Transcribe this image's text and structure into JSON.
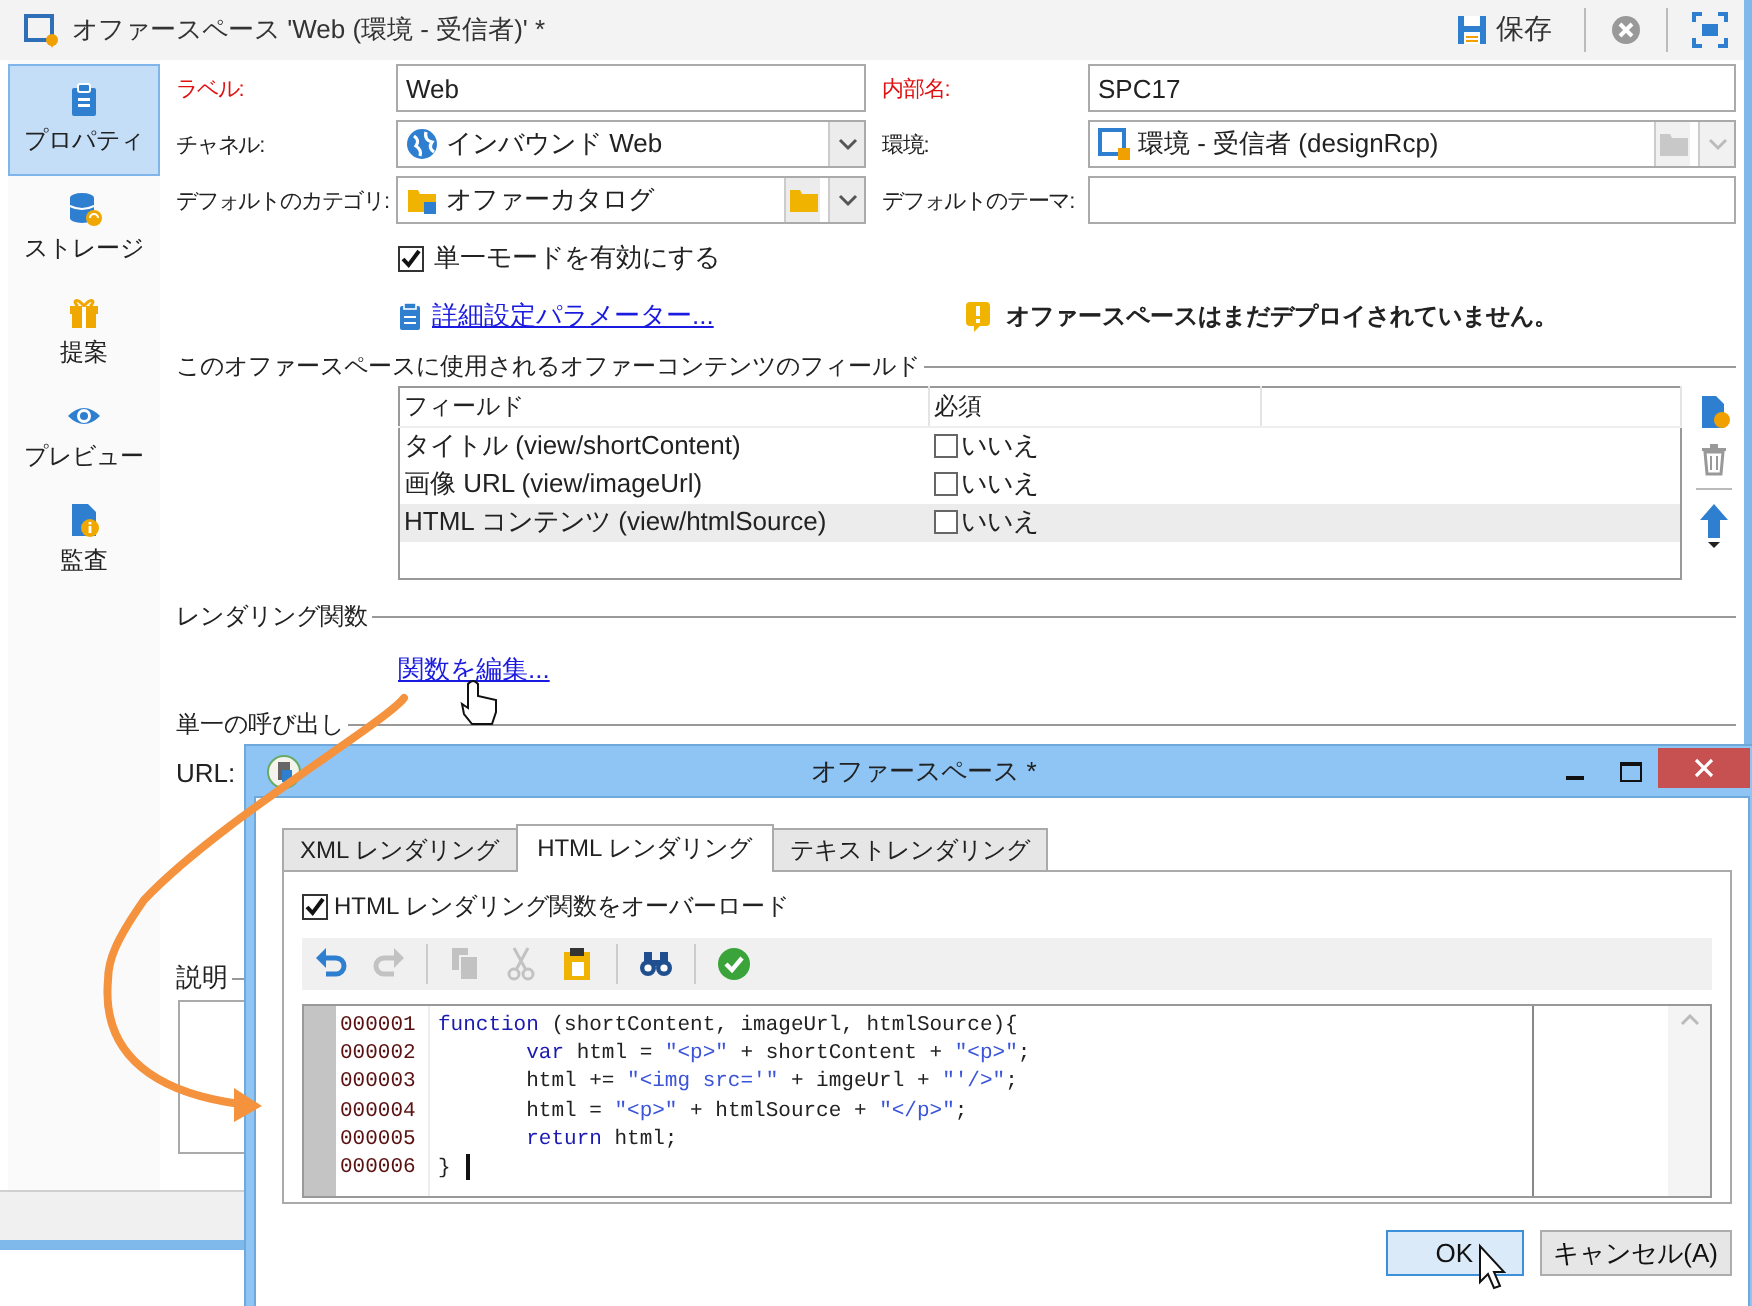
{
  "window": {
    "title": "オファースペース 'Web (環境 - 受信者)' *",
    "save": "保存"
  },
  "sidebar": {
    "items": [
      {
        "label": "プロパティ",
        "selected": true
      },
      {
        "label": "ストレージ",
        "selected": false
      },
      {
        "label": "提案",
        "selected": false
      },
      {
        "label": "プレビュー",
        "selected": false
      },
      {
        "label": "監査",
        "selected": false
      }
    ]
  },
  "fields": [
    {
      "label": "ラベル:",
      "required": true,
      "kind": "text",
      "value": "Web"
    },
    {
      "label": "内部名:",
      "required": true,
      "kind": "text",
      "value": "SPC17"
    },
    {
      "label": "チャネル:",
      "required": false,
      "kind": "select",
      "value": "インバウンド Web"
    },
    {
      "label": "環境:",
      "required": false,
      "kind": "locked-link",
      "value": "環境 - 受信者 (designRcp)"
    },
    {
      "label": "デフォルトのカテゴリ:",
      "required": false,
      "kind": "link",
      "value": "オファーカタログ"
    },
    {
      "label": "デフォルトのテーマ:",
      "required": false,
      "kind": "text"
    }
  ],
  "single_mode": {
    "label": "単一モードを有効にする",
    "checked": true
  },
  "advanced_link": "詳細設定パラメーター...",
  "warning": "オファースペースはまだデプロイされていません。",
  "content_fields": {
    "title": "このオファースペースに使用されるオファーコンテンツのフィールド",
    "columns": [
      "フィールド",
      "必須"
    ],
    "rows": [
      {
        "field": "タイトル (view/shortContent)",
        "required_label": "いいえ",
        "required": false,
        "selected": false
      },
      {
        "field": "画像 URL (view/imageUrl)",
        "required_label": "いいえ",
        "required": false,
        "selected": false
      },
      {
        "field": "HTML コンテンツ (view/htmlSource)",
        "required_label": "いいえ",
        "required": false,
        "selected": true
      }
    ]
  },
  "rendering": {
    "title": "レンダリング関数",
    "link": "関数を編集..."
  },
  "single_call": {
    "title": "単一の呼び出し",
    "url_label": "URL:"
  },
  "description": {
    "title": "説明"
  },
  "dialog": {
    "title": "オファースペース *",
    "tabs": [
      {
        "label": "XML レンダリング",
        "selected": false
      },
      {
        "label": "HTML レンダリング",
        "selected": true
      },
      {
        "label": "テキストレンダリング",
        "selected": false
      }
    ],
    "overload": {
      "label": "HTML レンダリング関数をオーバーロード",
      "checked": true
    },
    "toolbar": [
      {
        "disabled": false
      },
      {
        "disabled": true
      },
      {
        "disabled": true
      },
      {
        "disabled": true
      },
      {
        "disabled": false
      },
      {
        "disabled": false
      },
      {
        "disabled": false
      }
    ],
    "code": [
      {
        "number": "000001",
        "text": "function (shortContent, imageUrl, htmlSource){"
      },
      {
        "number": "000002",
        "text": "       var html = \"<p>\" + shortContent + \"<p>\";"
      },
      {
        "number": "000003",
        "text": "       html += \"<img src='\" + imgeUrl + \"'/>\";"
      },
      {
        "number": "000004",
        "text": "       html = \"<p>\" + htmlSource + \"</p>\";"
      },
      {
        "number": "000005",
        "text": "       return html;"
      },
      {
        "number": "000006",
        "text": "} "
      }
    ],
    "buttons": [
      {
        "label": "OK",
        "default": true
      },
      {
        "label": "キャンセル(A)",
        "default": false
      }
    ]
  }
}
